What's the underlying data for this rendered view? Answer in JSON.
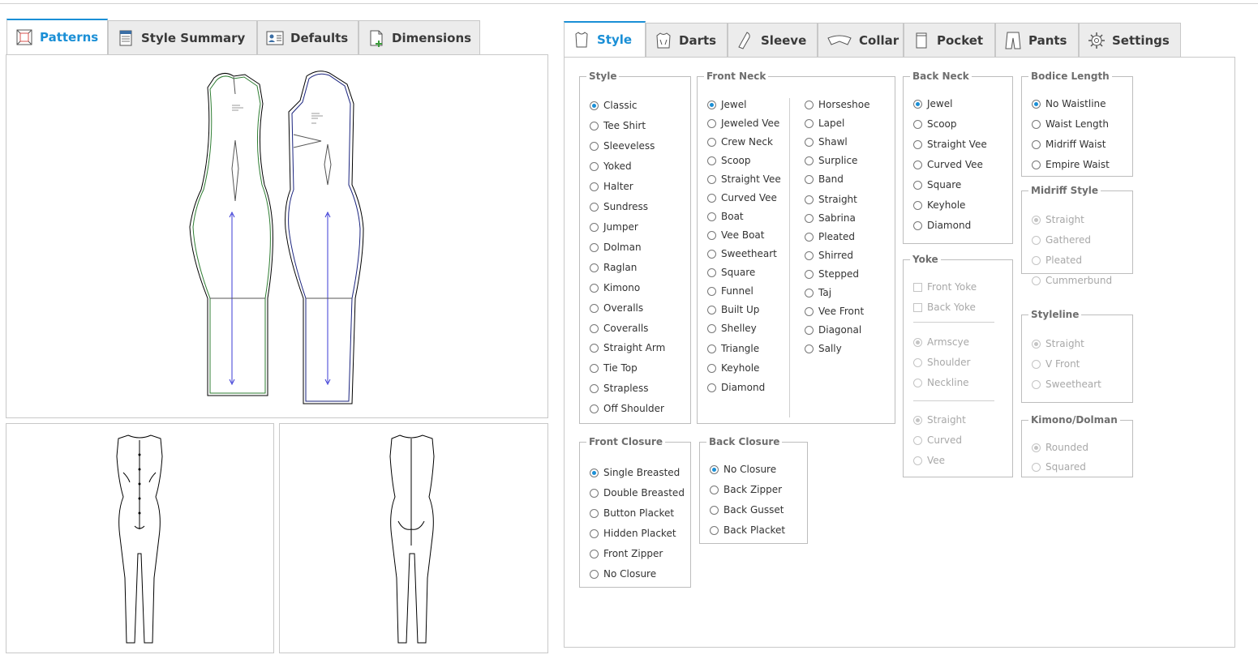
{
  "left_tabs": [
    {
      "label": "Patterns",
      "icon": "patterns-icon",
      "active": true
    },
    {
      "label": "Style Summary",
      "icon": "style-summary-icon",
      "active": false
    },
    {
      "label": "Defaults",
      "icon": "defaults-icon",
      "active": false
    },
    {
      "label": "Dimensions",
      "icon": "dimensions-icon",
      "active": false
    }
  ],
  "right_tabs": [
    {
      "label": "Style",
      "icon": "shirt-icon",
      "active": true
    },
    {
      "label": "Darts",
      "icon": "darts-icon",
      "active": false
    },
    {
      "label": "Sleeve",
      "icon": "sleeve-icon",
      "active": false
    },
    {
      "label": "Collar",
      "icon": "collar-icon",
      "active": false
    },
    {
      "label": "Pocket",
      "icon": "pocket-icon",
      "active": false
    },
    {
      "label": "Pants",
      "icon": "pants-icon",
      "active": false
    },
    {
      "label": "Settings",
      "icon": "gear-icon",
      "active": false
    }
  ],
  "groups": {
    "style": {
      "legend": "Style",
      "options": [
        "Classic",
        "Tee Shirt",
        "Sleeveless",
        "Yoked",
        "Halter",
        "Sundress",
        "Jumper",
        "Dolman",
        "Raglan",
        "Kimono",
        "Overalls",
        "Coveralls",
        "Straight Arm",
        "Tie Top",
        "Strapless",
        "Off Shoulder"
      ],
      "selected": "Classic"
    },
    "front_neck": {
      "legend": "Front Neck",
      "col1": [
        "Jewel",
        "Jeweled Vee",
        "Crew Neck",
        "Scoop",
        "Straight Vee",
        "Curved Vee",
        "Boat",
        "Vee Boat",
        "Sweetheart",
        "Square",
        "Funnel",
        "Built Up",
        "Shelley",
        "Triangle",
        "Keyhole",
        "Diamond"
      ],
      "col2": [
        "Horseshoe",
        "Lapel",
        "Shawl",
        "Surplice",
        "Band",
        "Straight",
        "Sabrina",
        "Pleated",
        "Shirred",
        "Stepped",
        "Taj",
        "Vee Front",
        "Diagonal",
        "Sally"
      ],
      "selected": "Jewel"
    },
    "back_neck": {
      "legend": "Back Neck",
      "options": [
        "Jewel",
        "Scoop",
        "Straight Vee",
        "Curved Vee",
        "Square",
        "Keyhole",
        "Diamond"
      ],
      "selected": "Jewel"
    },
    "bodice_length": {
      "legend": "Bodice Length",
      "options": [
        "No Waistline",
        "Waist Length",
        "Midriff Waist",
        "Empire Waist"
      ],
      "selected": "No Waistline"
    },
    "midriff_style": {
      "legend": "Midriff Style",
      "options": [
        "Straight",
        "Gathered",
        "Pleated",
        "Cummerbund"
      ],
      "selected": "Straight",
      "disabled": true
    },
    "yoke": {
      "legend": "Yoke",
      "checks": [
        "Front Yoke",
        "Back Yoke"
      ],
      "placement": [
        "Armscye",
        "Shoulder",
        "Neckline"
      ],
      "placement_selected": "Armscye",
      "shape": [
        "Straight",
        "Curved",
        "Vee"
      ],
      "shape_selected": "Straight",
      "disabled": true
    },
    "styleline": {
      "legend": "Styleline",
      "options": [
        "Straight",
        "V Front",
        "Sweetheart"
      ],
      "selected": "Straight",
      "disabled": true
    },
    "kimono_dolman": {
      "legend": "Kimono/Dolman",
      "options": [
        "Rounded",
        "Squared"
      ],
      "selected": "Rounded",
      "disabled": true
    },
    "front_closure": {
      "legend": "Front Closure",
      "options": [
        "Single Breasted",
        "Double Breasted",
        "Button Placket",
        "Hidden Placket",
        "Front Zipper",
        "No Closure"
      ],
      "selected": "Single Breasted"
    },
    "back_closure": {
      "legend": "Back Closure",
      "options": [
        "No Closure",
        "Back Zipper",
        "Back Gusset",
        "Back Placket"
      ],
      "selected": "No Closure"
    }
  },
  "colors": {
    "accent": "#1a8fd6",
    "front_outline": "#2e7d32",
    "back_outline": "#1a237e"
  }
}
